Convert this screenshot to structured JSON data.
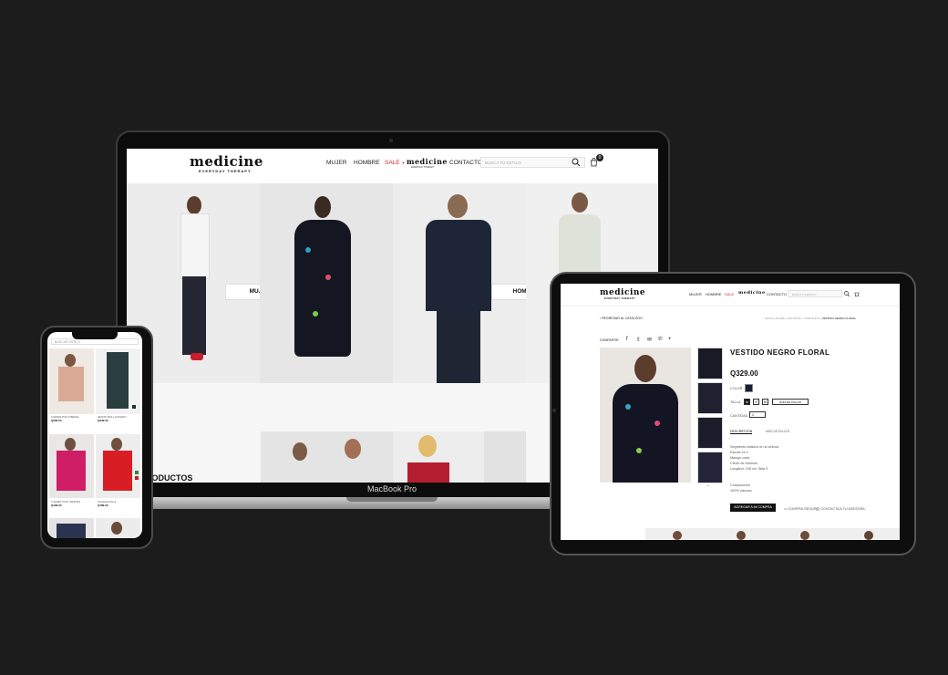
{
  "brand": {
    "name": "medicine",
    "tagline": "EVERYDAY THERAPY"
  },
  "laptop": {
    "model_label": "MacBook Pro",
    "nav": {
      "items": [
        "MUJER",
        "HOMBRE",
        "SALE",
        "CONTACTO"
      ],
      "search_placeholder": "BUSCA TU ESTILO",
      "cart_count": "0"
    },
    "hero": {
      "women_button": "MUJER",
      "men_button": "HOMBRE"
    },
    "section_heading": "RODUCTOS"
  },
  "tablet": {
    "back_link": "REGRESAR AL CATÁLOGO",
    "breadcrumb": [
      "INICIO",
      "MUJER",
      "VESTIDOS Y JUMPSUITS",
      "VESTIDO NEGRO FLORAL"
    ],
    "share_label": "COMPARTIR",
    "product": {
      "title": "VESTIDO NEGRO FLORAL",
      "price": "Q329.00",
      "color_label": "COLOR",
      "size_label": "TALLA",
      "sizes": [
        "M",
        "S",
        "M"
      ],
      "size_guide": "GUÍA DE TALLAS",
      "qty_label": "CANTIDAD",
      "qty_value": "1",
      "tabs": [
        "DESCRIPCIÓN",
        "MÁS DETALLES"
      ],
      "description": [
        "Segmento elástico en la cintura",
        "Escote en v",
        "Manga corta",
        "Cierre de botones",
        "Longitud: 108 cm Talla S"
      ],
      "composition_label": "Composición",
      "composition_value": "100% viscosa",
      "add_to_cart": "AGREGAR A MI COMPRA",
      "shipping_label": "COMPRA SEGURA",
      "contact_label": "CONTACTA A TU ASESORA"
    }
  },
  "phone": {
    "search_placeholder": "BUSCAR ESTILO",
    "products": [
      {
        "name": "CAMISA POLO BEIGE",
        "price": "Q299.00"
      },
      {
        "name": "JEANS SKILL RAYADO",
        "price": "Q349.00"
      },
      {
        "name": "T-SHIRT CON INFIINTA",
        "price": "Q199.00"
      },
      {
        "name": "Camiseta Rock",
        "price": "Q189.00"
      }
    ]
  },
  "colors": {
    "background": "#1c1c1c",
    "accent_sale": "#d8232a",
    "button_dark": "#111111"
  }
}
